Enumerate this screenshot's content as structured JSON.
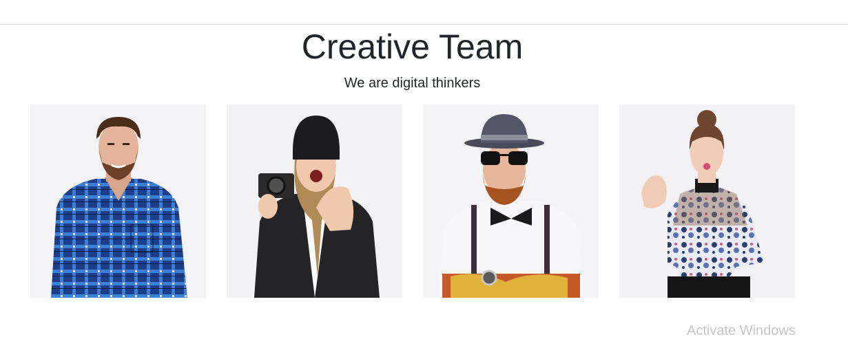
{
  "section": {
    "title": "Creative Team",
    "subtitle": "We are digital thinkers"
  },
  "team": [
    {
      "photo_icon": "man-plaid-shirt-photo"
    },
    {
      "photo_icon": "woman-camera-beanie-photo"
    },
    {
      "photo_icon": "man-hat-sunglasses-photo"
    },
    {
      "photo_icon": "woman-floral-top-photo"
    }
  ],
  "os_watermark": "Activate Windows",
  "colors": {
    "text": "#212529",
    "photo_background": "#f2f2f4",
    "divider": "#dee2e6"
  }
}
